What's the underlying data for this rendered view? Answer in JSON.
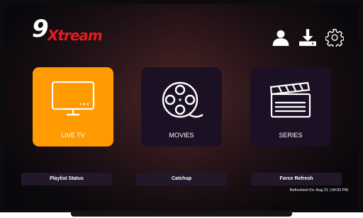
{
  "app": {
    "logo_number": "9",
    "logo_text": "Xtream",
    "brand_red": "#e11d1d"
  },
  "toolbar": {
    "icons": [
      "user-icon",
      "download-icon",
      "settings-icon"
    ]
  },
  "tiles": [
    {
      "label": "LIVE TV",
      "icon": "tv-icon",
      "active": true
    },
    {
      "label": "MOVIES",
      "icon": "film-reel-icon",
      "active": false
    },
    {
      "label": "SERIES",
      "icon": "clapperboard-icon",
      "active": false
    }
  ],
  "bottom_buttons": [
    {
      "label": "Playlist Status"
    },
    {
      "label": "Catchup"
    },
    {
      "label": "Force Refresh"
    }
  ],
  "status": {
    "refreshed_label": "Refreshed On:",
    "refreshed_value": "Aug 21 | 04:02 PM"
  },
  "colors": {
    "accent": "#ff9a00",
    "tile_bg": "#1c1124",
    "button_bg": "#23182a"
  }
}
